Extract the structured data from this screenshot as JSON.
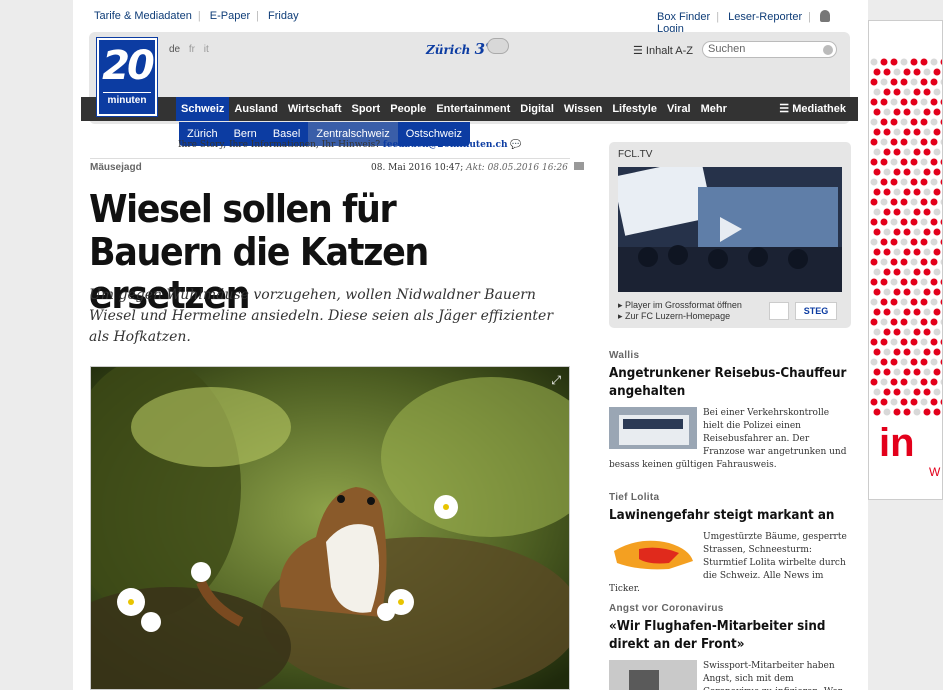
{
  "utility": {
    "left": [
      "Tarife & Mediadaten",
      "E-Paper",
      "Friday"
    ],
    "right": [
      "Box Finder",
      "Leser-Reporter",
      "Login"
    ]
  },
  "logo": {
    "num": "20",
    "word": "minuten"
  },
  "languages": [
    "de",
    "fr",
    "it"
  ],
  "weather": {
    "city": "Zürich",
    "temp": "3°"
  },
  "inhalt": "Inhalt A-Z",
  "search": {
    "placeholder": "Suchen"
  },
  "nav": [
    "Schweiz",
    "Ausland",
    "Wirtschaft",
    "Sport",
    "People",
    "Entertainment",
    "Digital",
    "Wissen",
    "Lifestyle",
    "Viral",
    "Mehr"
  ],
  "nav_active": "Schweiz",
  "mediathek": "Mediathek",
  "subnav": [
    "Zürich",
    "Bern",
    "Basel",
    "Zentralschweiz",
    "Ostschweiz"
  ],
  "subnav_active": "Zentralschweiz",
  "feedback": {
    "text": "Ihre Story, Ihre Informationen, Ihr Hinweis?",
    "email": "feedback@20minuten.ch"
  },
  "article": {
    "kicker": "Mäusejagd",
    "date": "08. Mai 2016 10:47;",
    "updated": "Akt: 08.05.2016 16:26",
    "headline": "Wiesel sollen für Bauern die Katzen ersetzen",
    "lead": "Um gegen Wühlmäuse vorzugehen, wollen Nidwaldner Bauern Wiesel und Hermeline ansiedeln. Diese seien als Jäger effizienter als Hofkatzen."
  },
  "fcl": {
    "title": "FCL.TV",
    "links": [
      "Player im Grossformat öffnen",
      "Zur FC Luzern-Homepage"
    ],
    "sponsor2": "STEG"
  },
  "sidebar": [
    {
      "kicker": "Wallis",
      "headline": "Angetrunkener Reisebus-Chauffeur angehalten",
      "body": "Bei einer Verkehrskontrolle hielt die Polizei einen Reisebusfahrer an. Der Franzose war angetrunken und besass keinen gültigen Fahrausweis."
    },
    {
      "kicker": "Tief Lolita",
      "headline": "Lawinengefahr steigt markant an",
      "body": "Umgestürzte Bäume, gesperrte Strassen, Schneesturm: Sturmtief Lolita wirbelte durch die Schweiz. Alle News im Ticker."
    },
    {
      "kicker": "Angst vor Coronavirus",
      "headline": "«Wir Flughafen-Mitarbeiter sind direkt an der Front»",
      "body": "Swissport-Mitarbeiter haben Angst, sich mit dem Coronavirus zu infizieren. Wer sich an den"
    }
  ],
  "ad": {
    "text": "in",
    "sub": "W"
  }
}
